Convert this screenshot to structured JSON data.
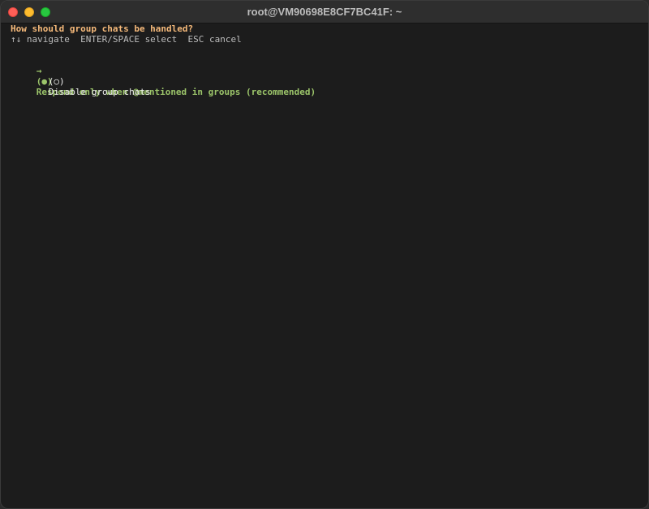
{
  "window": {
    "title": "root@VM90698E8CF7BC41F: ~"
  },
  "prompt": {
    "question": "How should group chats be handled?",
    "hint": "↑↓ navigate  ENTER/SPACE select  ESC cancel"
  },
  "options": [
    {
      "pointer": "→",
      "radio": "(●)",
      "label": "Respond only when @mentioned in groups (recommended)",
      "selected": true
    },
    {
      "pointer": "",
      "radio": "(○)",
      "label": "Disable group chats",
      "selected": false
    }
  ],
  "colors": {
    "question": "#f5b97a",
    "selected_option": "#9cc56a",
    "unselected_option": "#ececec",
    "hint": "#bdbdbd",
    "background": "#1c1c1c"
  }
}
